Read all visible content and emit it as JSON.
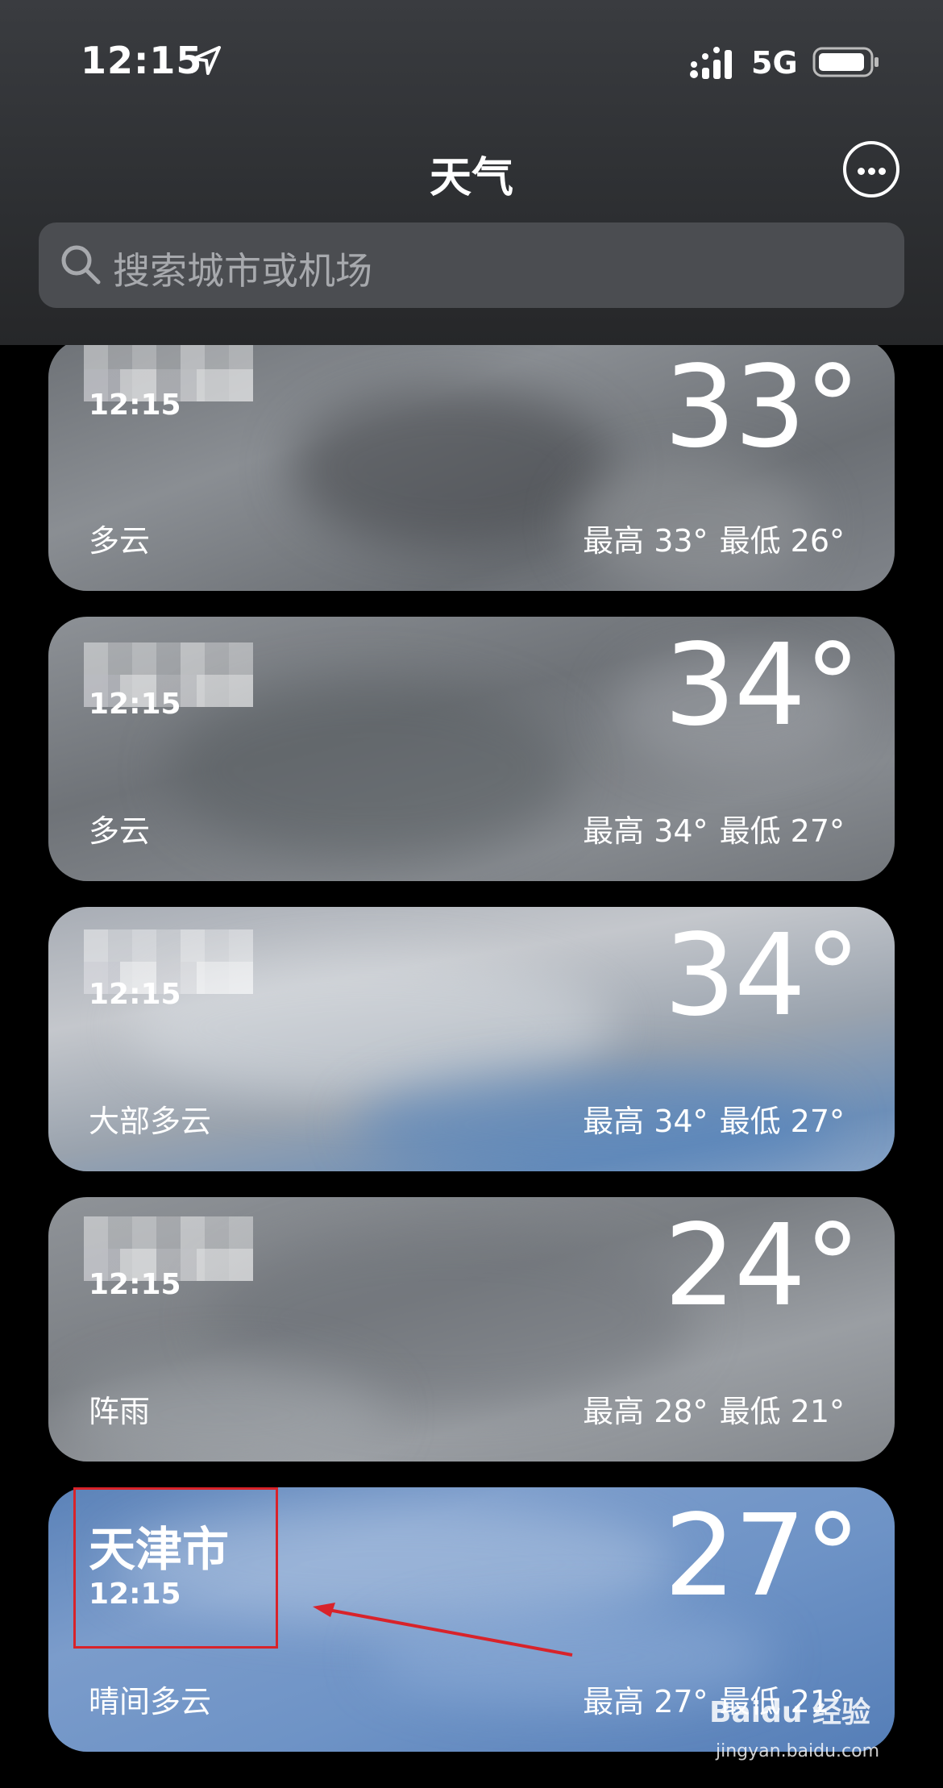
{
  "status_bar": {
    "time": "12:15",
    "network": "5G"
  },
  "header": {
    "title": "天气",
    "search_placeholder": "搜索城市或机场"
  },
  "cards": [
    {
      "city": "",
      "time": "12:15",
      "temp": "33°",
      "condition": "多云",
      "high": "最高 33°",
      "low": "最低 26°"
    },
    {
      "city": "",
      "time": "12:15",
      "temp": "34°",
      "condition": "多云",
      "high": "最高 34°",
      "low": "最低 27°"
    },
    {
      "city": "",
      "time": "12:15",
      "temp": "34°",
      "condition": "大部多云",
      "high": "最高 34°",
      "low": "最低 27°"
    },
    {
      "city": "",
      "time": "12:15",
      "temp": "24°",
      "condition": "阵雨",
      "high": "最高 28°",
      "low": "最低 21°"
    },
    {
      "city": "天津市",
      "time": "12:15",
      "temp": "27°",
      "condition": "晴间多云",
      "high": "最高 27°",
      "low": "最低 21°"
    }
  ],
  "watermark": {
    "brand": "Baidu 经验",
    "url": "jingyan.baidu.com"
  },
  "colors": {
    "highlight": "#d8232a",
    "header_bg": "#2e3033"
  }
}
